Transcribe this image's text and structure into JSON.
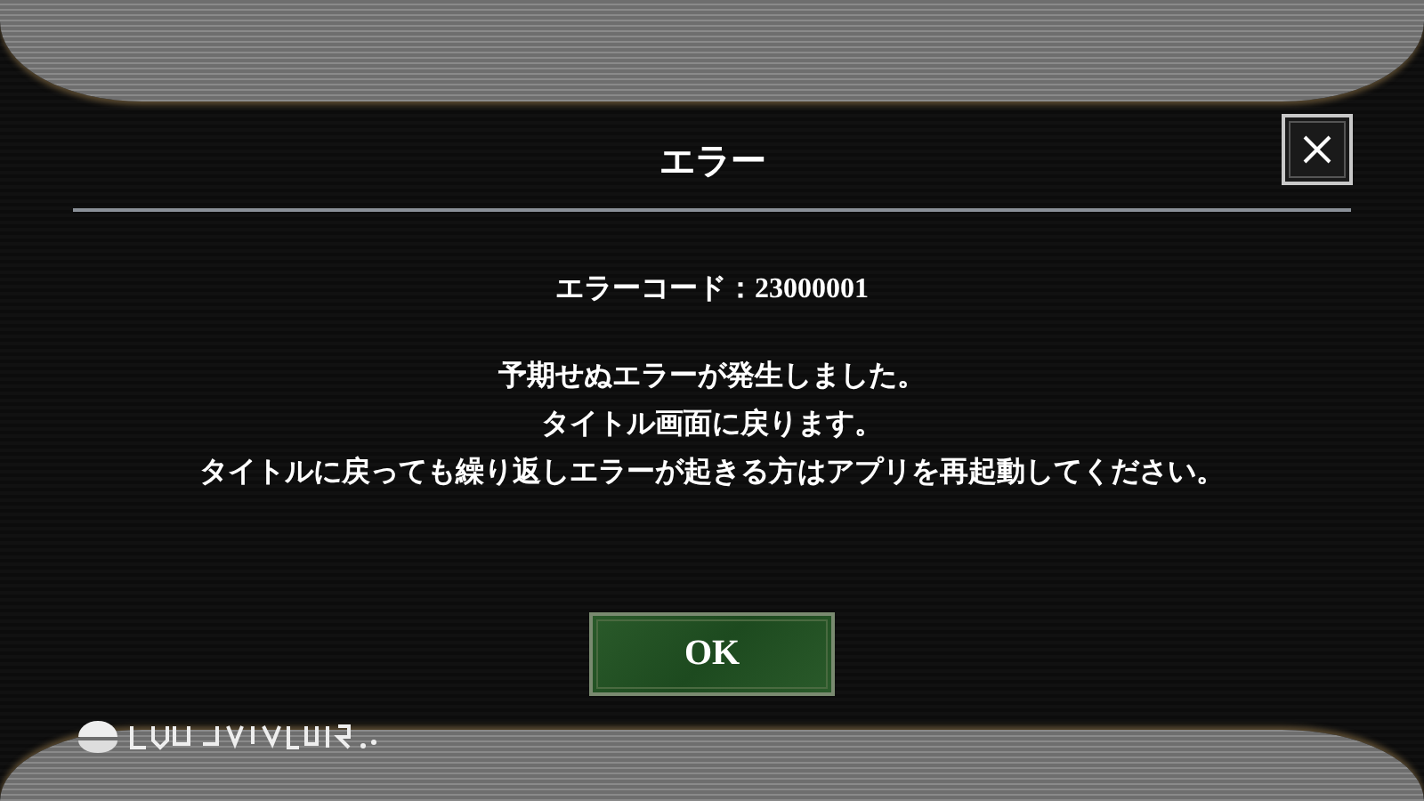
{
  "dialog": {
    "title": "エラー",
    "error_code": "エラーコード：23000001",
    "message_lines": [
      "予期せぬエラーが発生しました。",
      "タイトル画面に戻ります。",
      "タイトルに戻っても繰り返しエラーが起きる方はアプリを再起動してください。"
    ],
    "buttons": [
      {
        "label": "OK"
      }
    ]
  }
}
